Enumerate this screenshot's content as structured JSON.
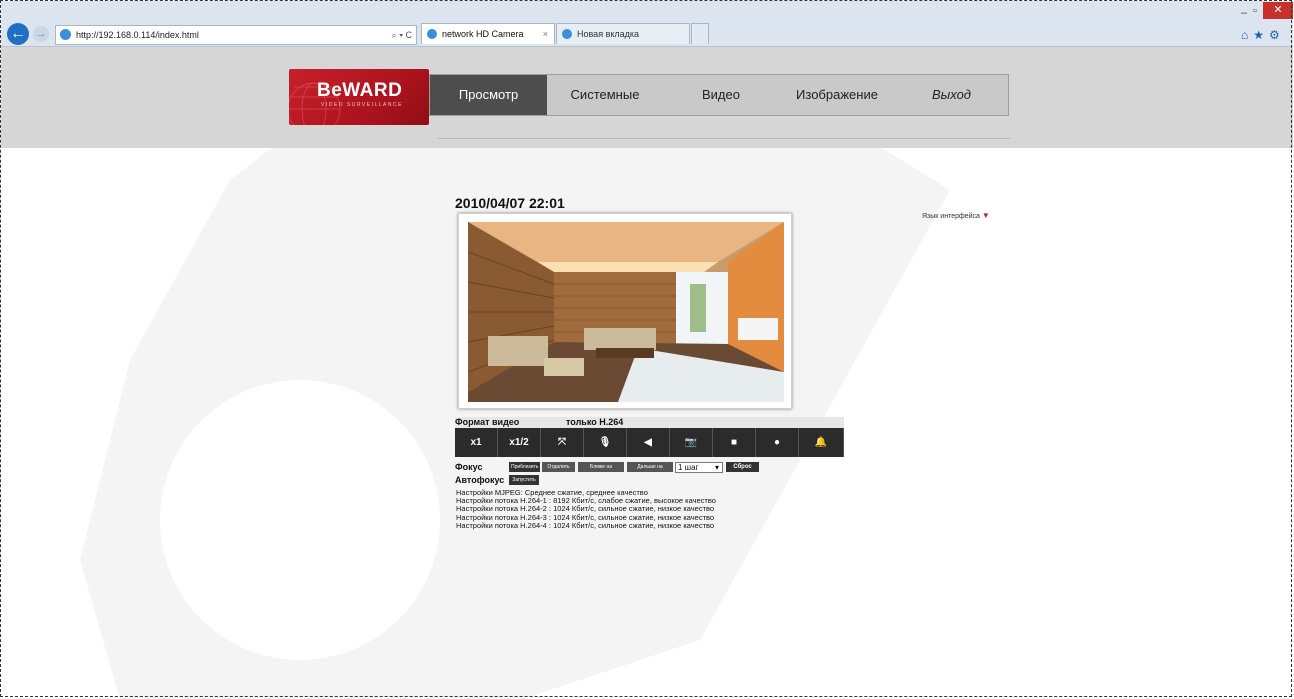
{
  "browser": {
    "url": "http://192.168.0.114/index.html",
    "tools": "⌕ ▾ C",
    "tabs": [
      {
        "title": "network HD Camera",
        "close": "×"
      },
      {
        "title": "Новая вкладка"
      }
    ],
    "window_controls": {
      "minimize": "–",
      "maximize": "▫",
      "close": "✕"
    },
    "right_icons": "⌂★⚙"
  },
  "logo": {
    "brand": "BeWARD",
    "sub": "VIDEO SURVEILLANCE"
  },
  "menu": {
    "items": [
      "Просмотр",
      "Системные",
      "Видео",
      "Изображение",
      "Выход"
    ],
    "active": "Просмотр"
  },
  "datetime": "2010/04/07 22:01",
  "language": {
    "label": "Язык интерфейса",
    "arrow": "▼"
  },
  "video_format": {
    "label": "Формат видео",
    "value": "только H.264"
  },
  "controls": {
    "buttons": [
      {
        "name": "x1",
        "label": "x1"
      },
      {
        "name": "x1-2",
        "label": "x1/2"
      },
      {
        "name": "fullscreen",
        "label": "⤧"
      },
      {
        "name": "microphone",
        "label": "🎙"
      },
      {
        "name": "speaker",
        "label": "◀"
      },
      {
        "name": "snapshot",
        "label": "📷"
      },
      {
        "name": "stop",
        "label": "■"
      },
      {
        "name": "record",
        "label": "●"
      },
      {
        "name": "alarm",
        "label": "🔔"
      }
    ]
  },
  "focus": {
    "label": "Фокус",
    "buttons": [
      "Приблизить",
      "Отдалить",
      "Ближе на",
      "Дальше на"
    ],
    "step_value": "1 шаг",
    "reset": "Сброс"
  },
  "autofocus": {
    "label": "Автофокус",
    "button": "Запустить"
  },
  "stream_settings": [
    "Настройки MJPEG: Среднее сжатие, среднее качество",
    "Настройки потока H.264-1 : 8192 Кбит/с, слабое сжатие, высокое качество",
    "Настройки потока H.264-2 : 1024 Кбит/с, сильное сжатие, низкое качество",
    "Настройки потока H.264-3 : 1024 Кбит/с, сильное сжатие, низкое качество",
    "Настройки потока H.264-4 : 1024 Кбит/с, сильное сжатие, низкое качество"
  ],
  "colors": {
    "brand_red": "#c8202b",
    "menu_active": "#4d4d4d",
    "header_bg": "#d6d6d6",
    "control_bg": "#2b2b2b"
  }
}
